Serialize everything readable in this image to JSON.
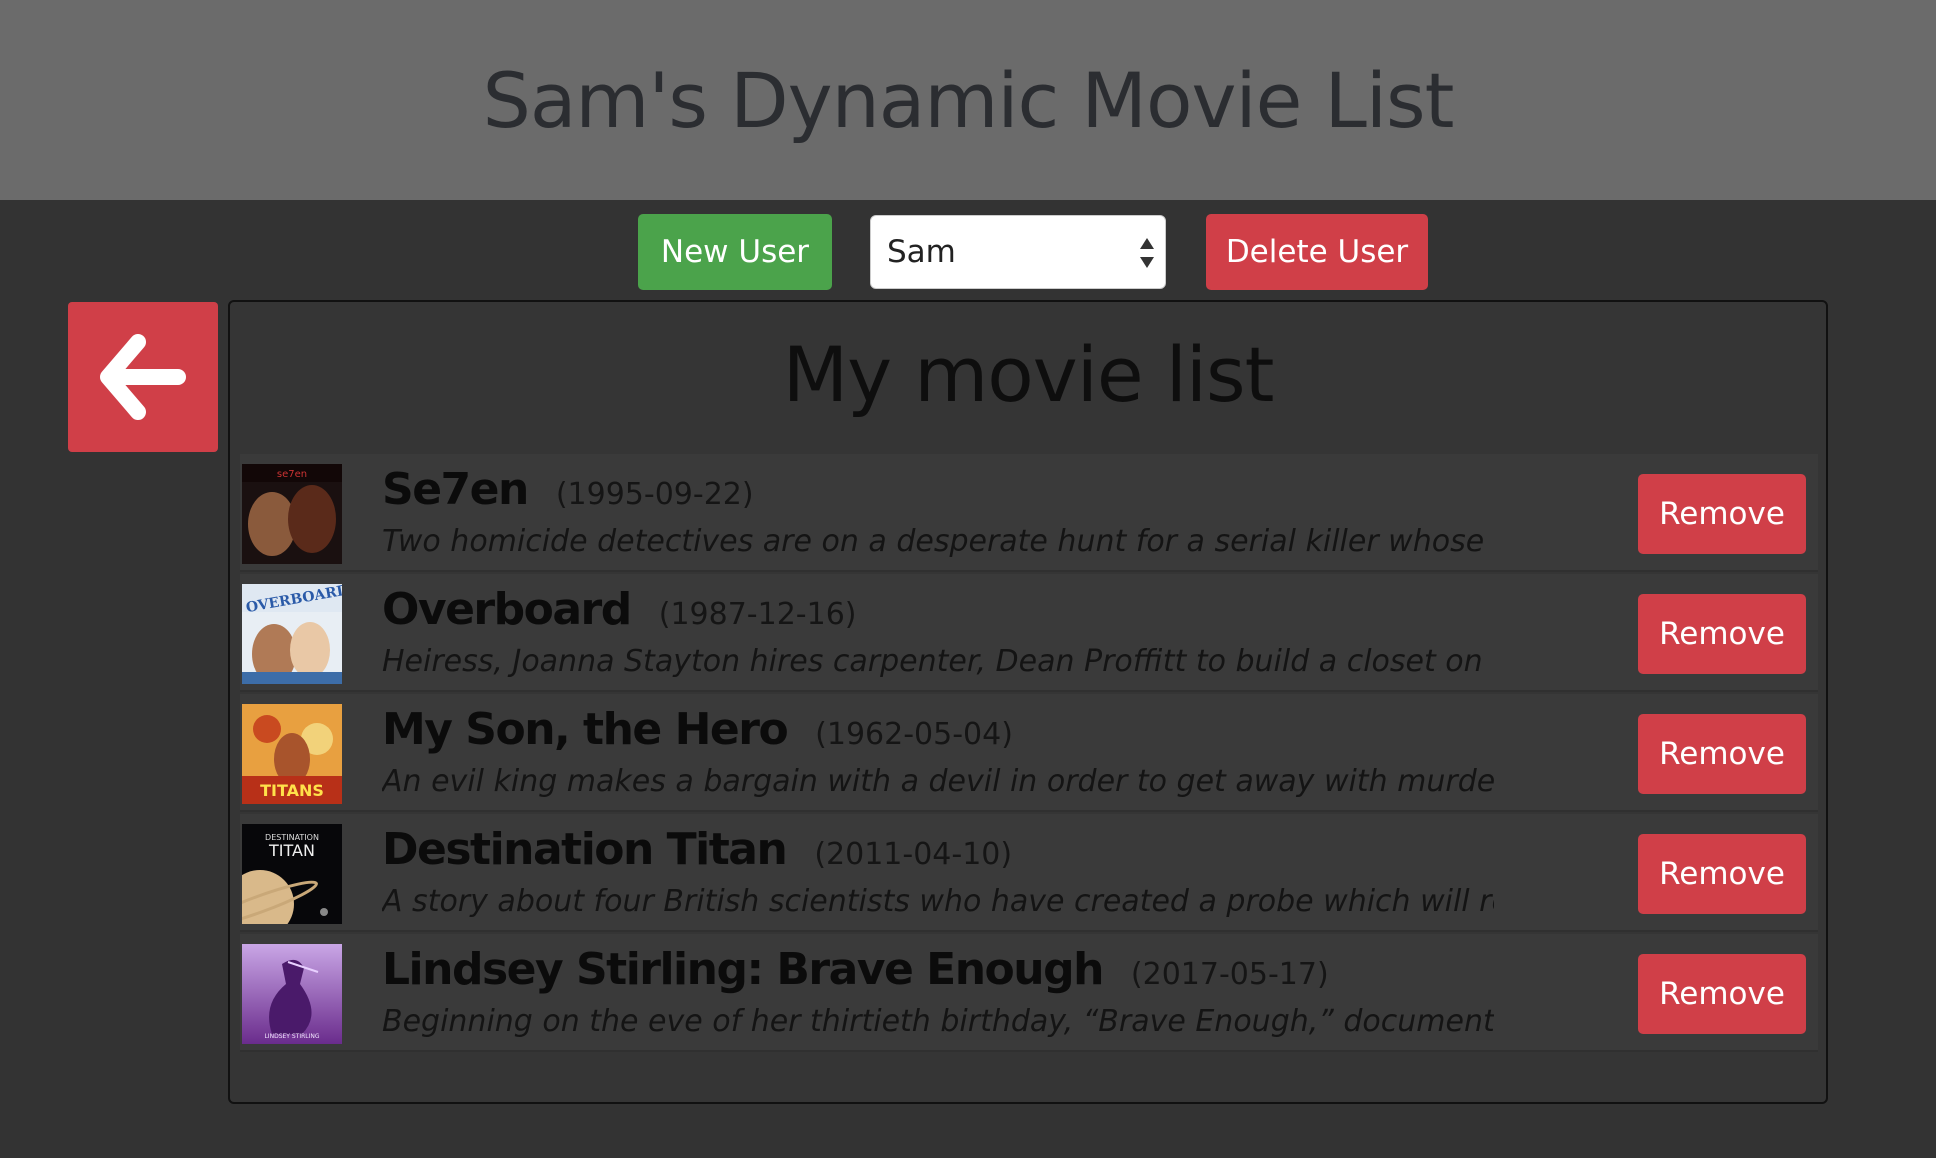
{
  "header": {
    "title": "Sam's Dynamic Movie List"
  },
  "controls": {
    "new_user_label": "New User",
    "user_select_value": "Sam",
    "delete_user_label": "Delete User"
  },
  "panel": {
    "title": "My movie list"
  },
  "movies": [
    {
      "title": "Se7en",
      "date": "(1995-09-22)",
      "description": "Two homicide detectives are on a desperate hunt for a serial killer whose",
      "remove_label": "Remove"
    },
    {
      "title": "Overboard",
      "date": "(1987-12-16)",
      "description": "Heiress, Joanna Stayton hires carpenter, Dean Proffitt to build a closet on",
      "remove_label": "Remove"
    },
    {
      "title": "My Son, the Hero",
      "date": "(1962-05-04)",
      "description": "An evil king makes a bargain with a devil in order to get away with murder",
      "remove_label": "Remove"
    },
    {
      "title": "Destination Titan",
      "date": "(2011-04-10)",
      "description": "A story about four British scientists who have created a probe which will reach",
      "remove_label": "Remove"
    },
    {
      "title": "Lindsey Stirling: Brave Enough",
      "date": "(2017-05-17)",
      "description": "Beginning on the eve of her thirtieth birthday, “Brave Enough,” documents",
      "remove_label": "Remove"
    }
  ],
  "posters": {
    "overboard_text": "OVERBOARD",
    "titans_text": "TITANS",
    "destination_small": "DESTINATION",
    "destination_big": "TITAN",
    "lindsey_text": "LINDSEY STIRLING"
  },
  "icons": {
    "back": "arrow-left-icon",
    "select": "select-arrows-icon"
  },
  "colors": {
    "header_bg": "#6b6b6b",
    "page_bg": "#333333",
    "green": "#4ba34b",
    "red": "#d03f48"
  }
}
